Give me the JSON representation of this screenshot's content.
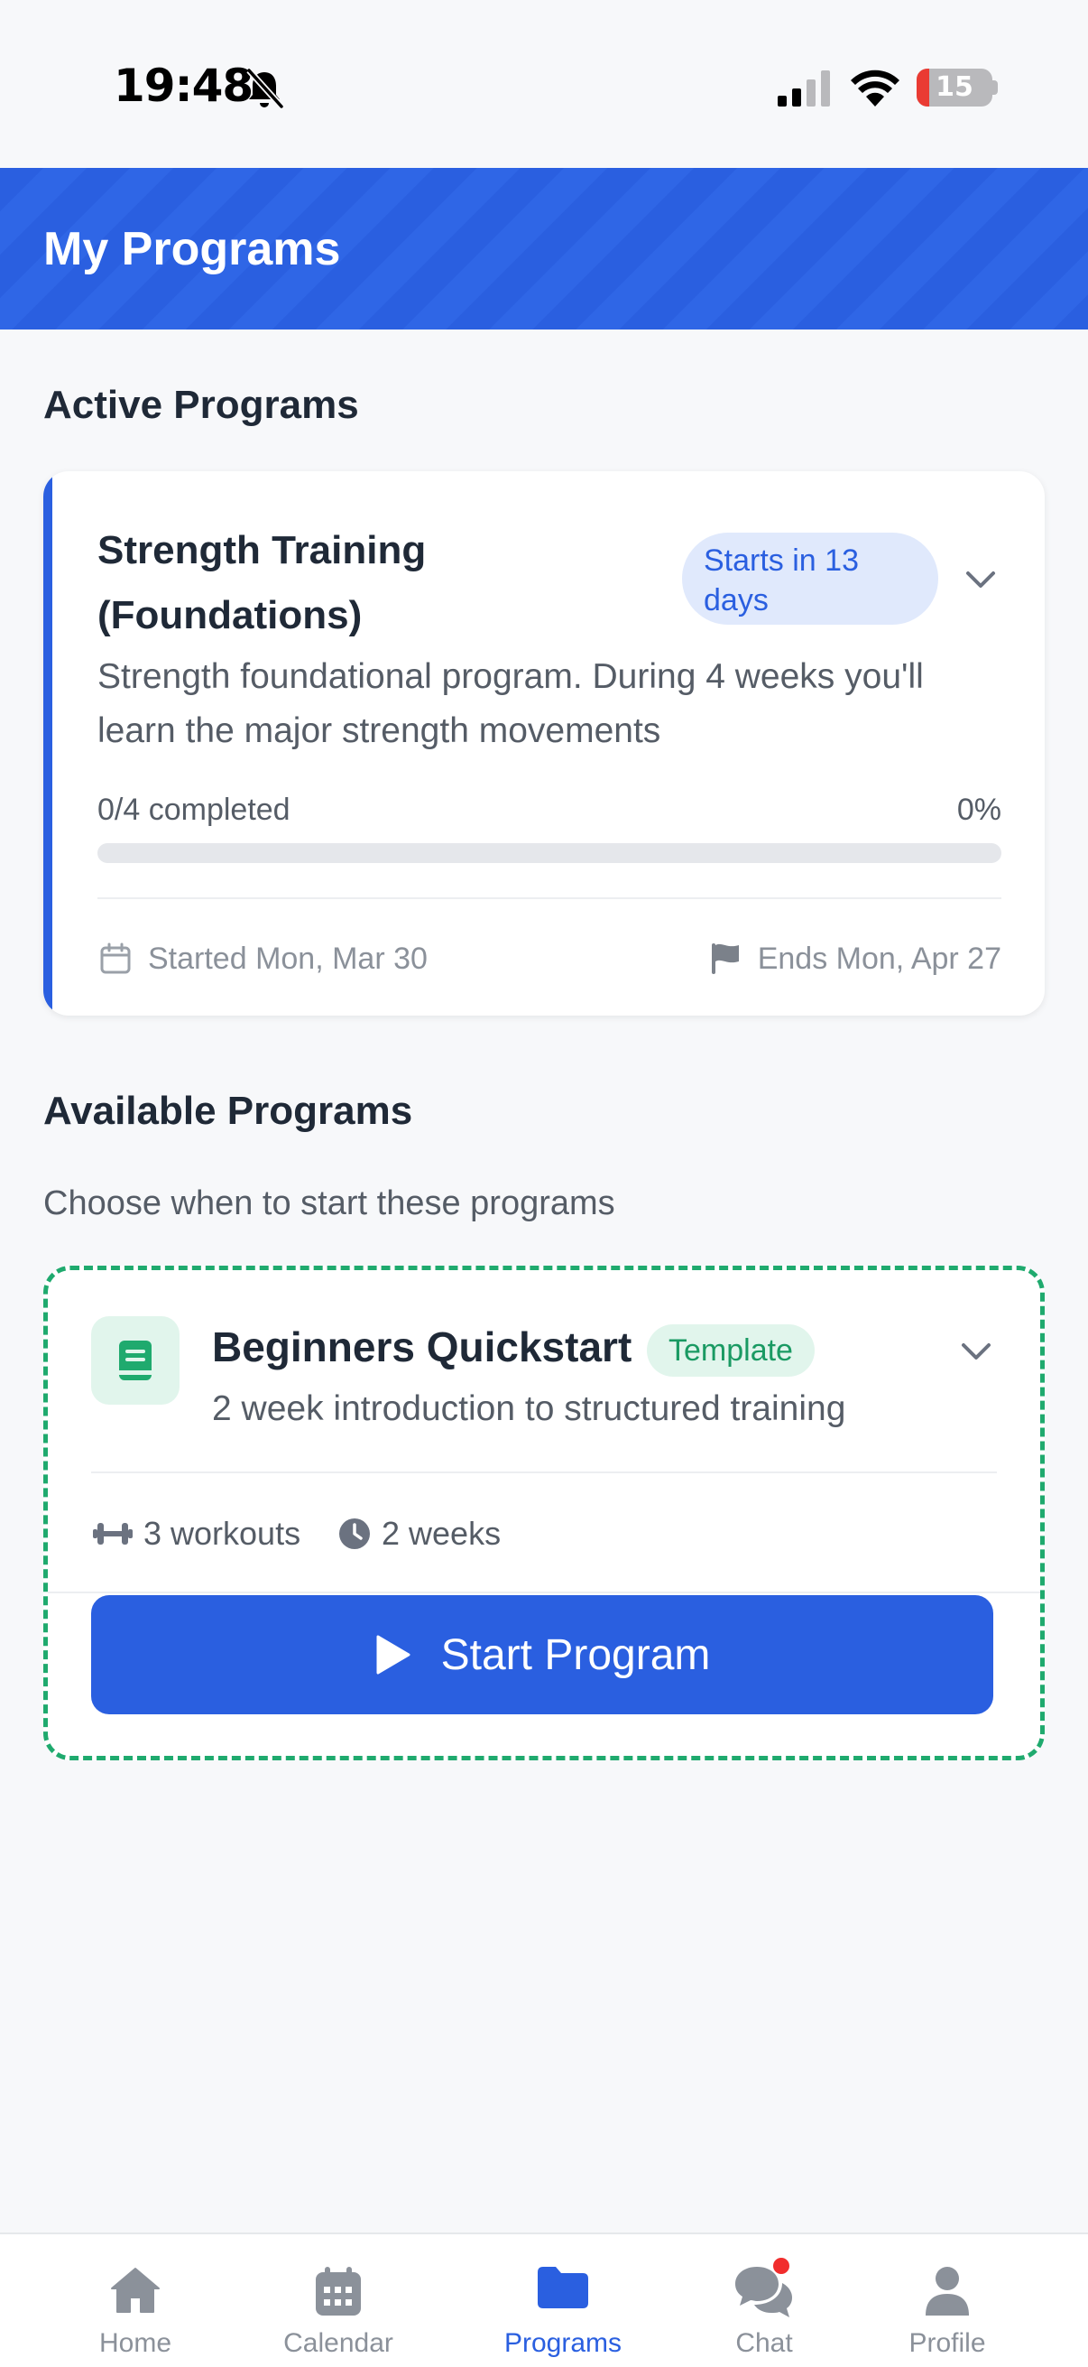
{
  "status_bar": {
    "time": "19:48",
    "battery_level": "15"
  },
  "header": {
    "title": "My Programs"
  },
  "active_section": {
    "title": "Active Programs",
    "program": {
      "name": "Strength Training (Foundations)",
      "status_badge": "Starts in 13 days",
      "description": "Strength foundational program. During 4 weeks you'll learn the major strength movements",
      "completed_text": "0/4 completed",
      "percent_text": "0%",
      "progress_fraction": 0,
      "started_text": "Started Mon, Mar 30",
      "ends_text": "Ends Mon, Apr 27"
    }
  },
  "available_section": {
    "title": "Available Programs",
    "subtitle": "Choose when to start these programs",
    "program": {
      "name": "Beginners Quickstart",
      "badge": "Template",
      "description": "2 week introduction to structured training",
      "workouts": "3 workouts",
      "duration": "2 weeks",
      "start_button": "Start Program"
    }
  },
  "tab_bar": {
    "tabs": [
      {
        "label": "Home",
        "icon": "home-icon"
      },
      {
        "label": "Calendar",
        "icon": "calendar-icon"
      },
      {
        "label": "Programs",
        "icon": "folder-icon"
      },
      {
        "label": "Chat",
        "icon": "chat-icon"
      },
      {
        "label": "Profile",
        "icon": "person-icon"
      }
    ],
    "active_index": 2
  },
  "colors": {
    "primary": "#2a5fe0",
    "success": "#1faa6e",
    "notification": "#f12d2d"
  }
}
